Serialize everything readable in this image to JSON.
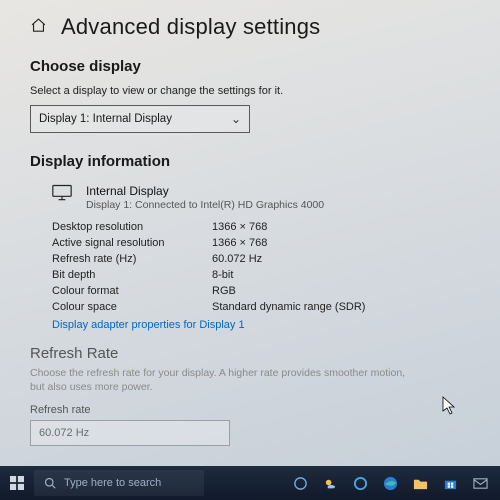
{
  "header": {
    "title": "Advanced display settings"
  },
  "choose": {
    "heading": "Choose display",
    "hint": "Select a display to view or change the settings for it.",
    "selected": "Display 1: Internal Display"
  },
  "info": {
    "heading": "Display information",
    "device_name": "Internal Display",
    "device_sub": "Display 1: Connected to Intel(R) HD Graphics 4000",
    "rows": [
      {
        "k": "Desktop resolution",
        "v": "1366 × 768"
      },
      {
        "k": "Active signal resolution",
        "v": "1366 × 768"
      },
      {
        "k": "Refresh rate (Hz)",
        "v": "60.072 Hz"
      },
      {
        "k": "Bit depth",
        "v": "8-bit"
      },
      {
        "k": "Colour format",
        "v": "RGB"
      },
      {
        "k": "Colour space",
        "v": "Standard dynamic range (SDR)"
      }
    ],
    "adapter_link": "Display adapter properties for Display 1"
  },
  "refresh": {
    "heading": "Refresh Rate",
    "desc": "Choose the refresh rate for your display. A higher rate provides smoother motion, but also uses more power.",
    "label": "Refresh rate",
    "value": "60.072 Hz"
  },
  "taskbar": {
    "search_placeholder": "Type here to search"
  }
}
